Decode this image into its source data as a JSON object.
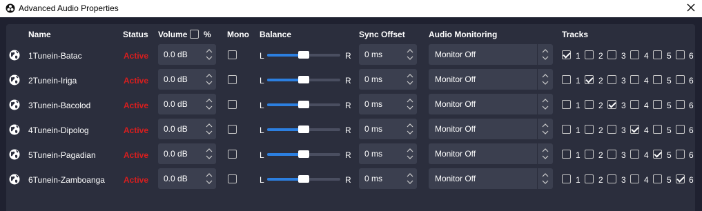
{
  "window": {
    "title": "Advanced Audio Properties",
    "close_icon": "close-icon",
    "app_icon": "obs-icon"
  },
  "headers": {
    "name": "Name",
    "status": "Status",
    "volume": "Volume",
    "volume_percent": "%",
    "mono": "Mono",
    "balance": "Balance",
    "sync_offset": "Sync Offset",
    "audio_monitoring": "Audio Monitoring",
    "tracks": "Tracks"
  },
  "balance_labels": {
    "left": "L",
    "right": "R"
  },
  "colors": {
    "status_active": "#d81e1e",
    "accent": "#2c7fe0",
    "panel": "#2b2e3d",
    "background": "#1f2130"
  },
  "sources": [
    {
      "name": "1Tunein-Batac",
      "status": "Active",
      "volume": "0.0 dB",
      "mono": false,
      "balance": 0.5,
      "sync_offset": "0 ms",
      "monitoring": "Monitor Off",
      "tracks": [
        true,
        false,
        false,
        false,
        false,
        false
      ]
    },
    {
      "name": "2Tunein-Iriga",
      "status": "Active",
      "volume": "0.0 dB",
      "mono": false,
      "balance": 0.5,
      "sync_offset": "0 ms",
      "monitoring": "Monitor Off",
      "tracks": [
        false,
        true,
        false,
        false,
        false,
        false
      ]
    },
    {
      "name": "3Tunein-Bacolod",
      "status": "Active",
      "volume": "0.0 dB",
      "mono": false,
      "balance": 0.5,
      "sync_offset": "0 ms",
      "monitoring": "Monitor Off",
      "tracks": [
        false,
        false,
        true,
        false,
        false,
        false
      ]
    },
    {
      "name": "4Tunein-Dipolog",
      "status": "Active",
      "volume": "0.0 dB",
      "mono": false,
      "balance": 0.5,
      "sync_offset": "0 ms",
      "monitoring": "Monitor Off",
      "tracks": [
        false,
        false,
        false,
        true,
        false,
        false
      ]
    },
    {
      "name": "5Tunein-Pagadian",
      "status": "Active",
      "volume": "0.0 dB",
      "mono": false,
      "balance": 0.5,
      "sync_offset": "0 ms",
      "monitoring": "Monitor Off",
      "tracks": [
        false,
        false,
        false,
        false,
        true,
        false
      ]
    },
    {
      "name": "6Tunein-Zamboanga",
      "status": "Active",
      "volume": "0.0 dB",
      "mono": false,
      "balance": 0.5,
      "sync_offset": "0 ms",
      "monitoring": "Monitor Off",
      "tracks": [
        false,
        false,
        false,
        false,
        false,
        true
      ]
    }
  ],
  "track_labels": [
    "1",
    "2",
    "3",
    "4",
    "5",
    "6"
  ]
}
